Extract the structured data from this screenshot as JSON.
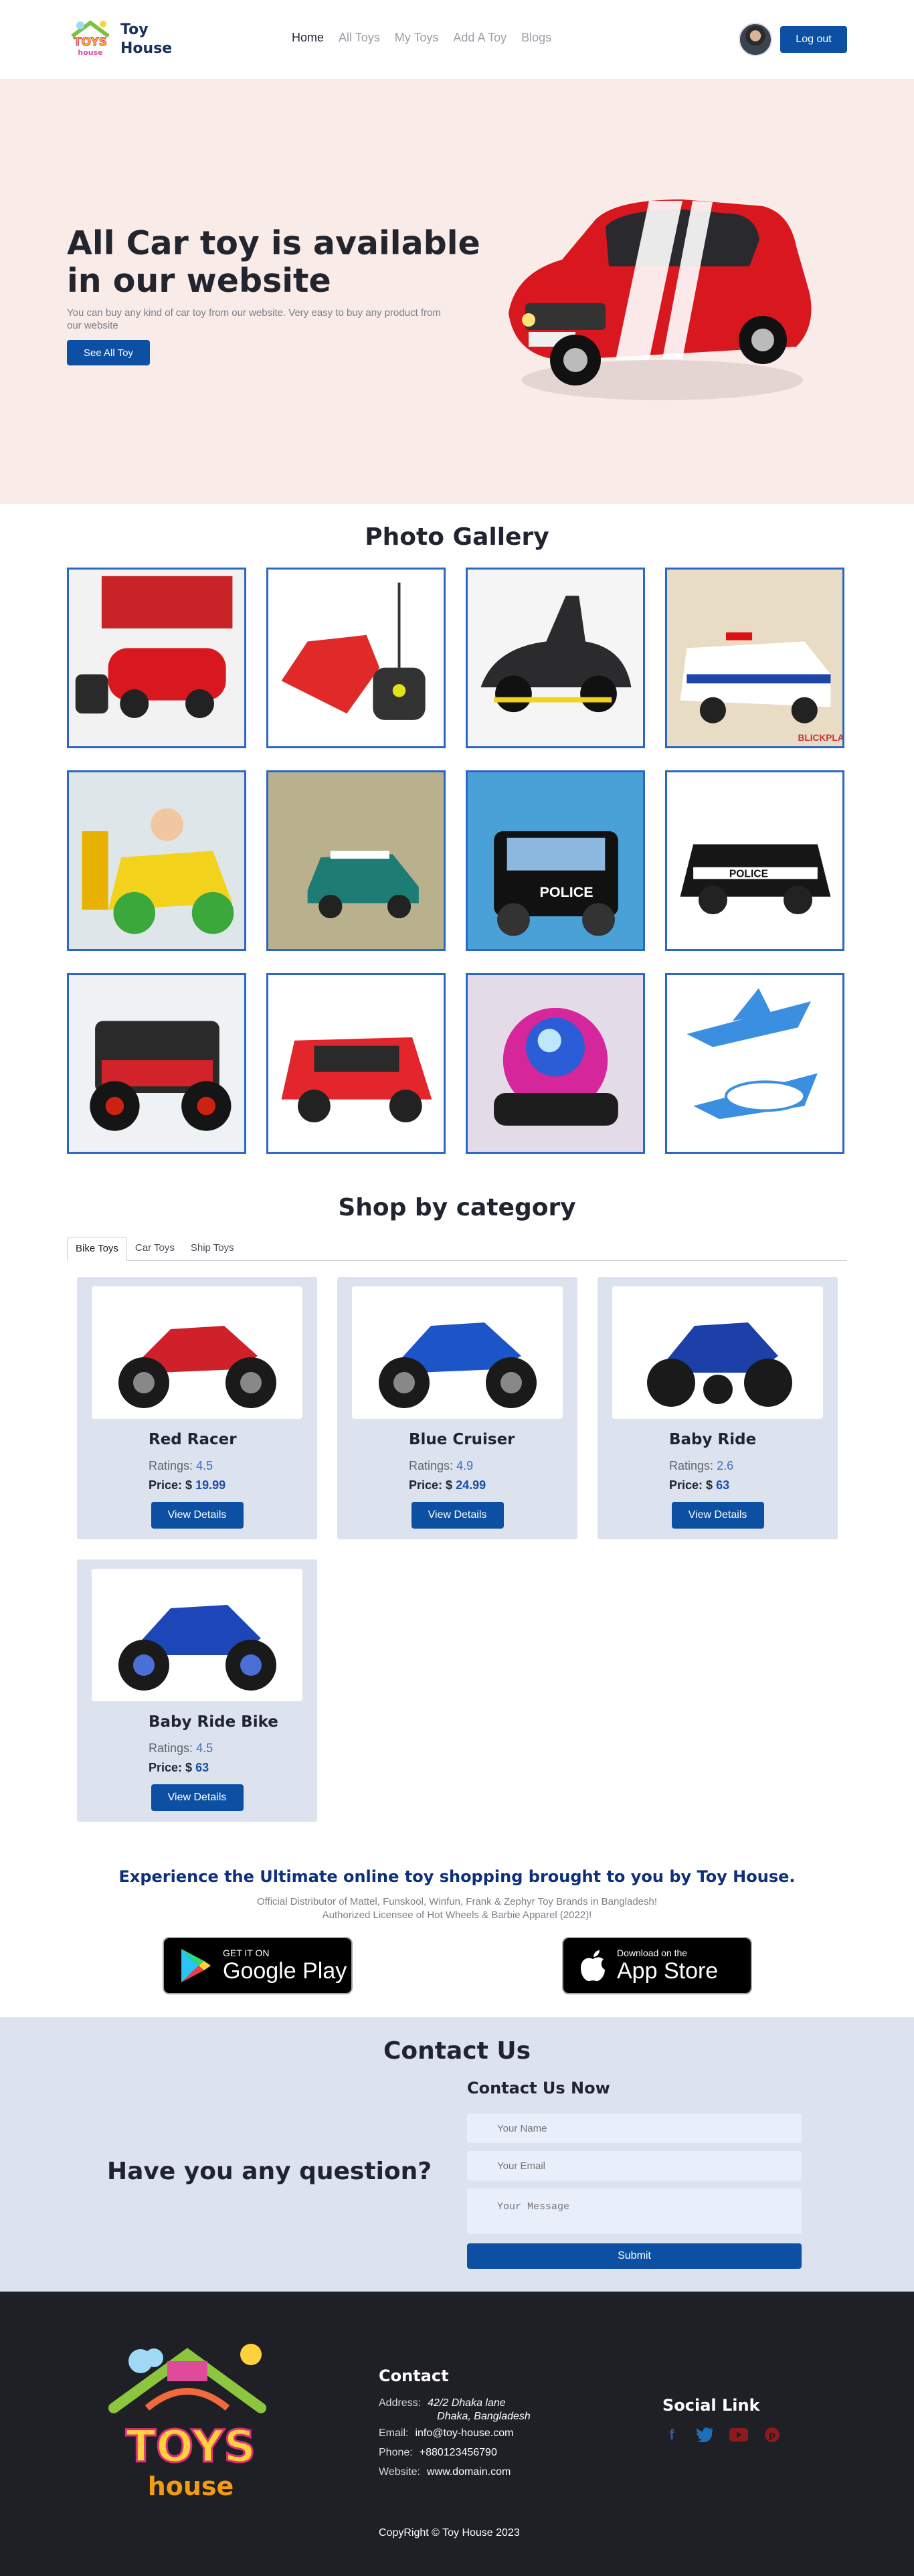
{
  "brand": {
    "line1": "Toy",
    "line2": "House"
  },
  "nav": {
    "links": [
      "Home",
      "All Toys",
      "My Toys",
      "Add A Toy",
      "Blogs"
    ],
    "logout": "Log out"
  },
  "hero": {
    "title": "All Car toy is available in our website",
    "subtitle": "You can buy any kind of car toy from our website. Very easy to buy any product from our website",
    "button": "See All Toy"
  },
  "gallery": {
    "title": "Photo Gallery",
    "watermark": "BLICKPLAY"
  },
  "category": {
    "title": "Shop by category",
    "tabs": [
      "Bike Toys",
      "Car Toys",
      "Ship Toys"
    ],
    "ratings_label": "Ratings:",
    "price_label": "Price: $",
    "view_label": "View Details",
    "products": [
      {
        "name": "Red Racer",
        "rating": "4.5",
        "price": "19.99",
        "color": "#d0202a"
      },
      {
        "name": "Blue Cruiser",
        "rating": "4.9",
        "price": "24.99",
        "color": "#1c55c8"
      },
      {
        "name": "Baby Ride",
        "rating": "2.6",
        "price": "63",
        "color": "#1c3fa8"
      },
      {
        "name": "Baby Ride Bike",
        "rating": "4.5",
        "price": "63",
        "color": "#1d46b8"
      }
    ]
  },
  "promo": {
    "title": "Experience the Ultimate online toy shopping brought to you by Toy House.",
    "subtitle": "Official Distributor of Mattel, Funskool, Winfun, Frank & Zephyr Toy Brands in Bangladesh! Authorized Licensee of Hot Wheels & Barbie Apparel (2022)!",
    "google_small": "GET IT ON",
    "google_big": "Google Play",
    "apple_small": "Download on the",
    "apple_big": "App Store"
  },
  "contact": {
    "title": "Contact Us",
    "question": "Have you any question?",
    "form_title": "Contact Us Now",
    "name_placeholder": "Your Name",
    "email_placeholder": "Your Email",
    "message_placeholder": "Your Message",
    "submit": "Submit"
  },
  "footer": {
    "logo_top": "TOYS",
    "logo_bottom": "house",
    "contact_title": "Contact",
    "address_label": "Address:",
    "address_line1": "42/2 Dhaka lane",
    "address_line2": "Dhaka, Bangladesh",
    "email_label": "Email:",
    "email": "info@toy-house.com",
    "phone_label": "Phone:",
    "phone": "+880123456790",
    "website_label": "Website:",
    "website": "www.domain.com",
    "social_title": "Social Link",
    "copyright": "CopyRight © Toy House 2023"
  },
  "colors": {
    "primary": "#0d4fa3",
    "hero_bg": "#f8ebe8",
    "card_bg": "#dde3ee",
    "footer_bg": "#1e2026"
  }
}
